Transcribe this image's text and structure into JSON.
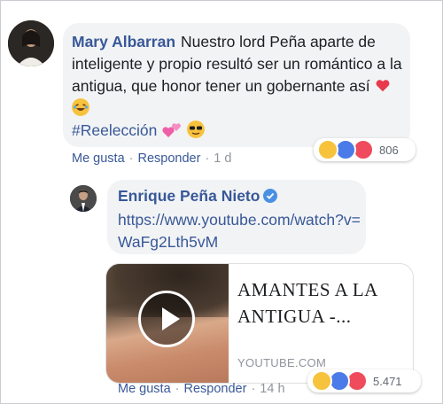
{
  "comment": {
    "author": "Mary Albarran",
    "text": "Nuestro lord Peña aparte de inteligente y propio resultó ser un romántico a la antigua, que honor tener un gobernante así",
    "hashtag": "#Reelección",
    "reactions_count": "806",
    "actions": {
      "like": "Me gusta",
      "reply": "Responder",
      "time": "1 d"
    }
  },
  "reply": {
    "author": "Enrique Peña Nieto",
    "link_text": "https://www.youtube.com/watch?v=WaFg2Lth5vM",
    "preview": {
      "title": "AMANTES A LA ANTIGUA -...",
      "domain": "YOUTUBE.COM"
    },
    "reactions_count": "5.471",
    "actions": {
      "like": "Me gusta",
      "reply": "Responder",
      "time": "14 h"
    }
  },
  "icons": {
    "verified": "verified-badge-icon",
    "reactions": [
      "haha-reaction-icon",
      "like-reaction-icon",
      "love-reaction-icon"
    ],
    "emojis": [
      "heart-emoji",
      "laughing-emoji",
      "sparkling-hearts-emoji",
      "sunglasses-emoji"
    ]
  },
  "colors": {
    "link": "#385898",
    "bubble": "#f2f3f5",
    "like": "#4a7be8",
    "love": "#ef4b5c",
    "haha": "#f7c23c",
    "verified": "#4a90e2"
  }
}
